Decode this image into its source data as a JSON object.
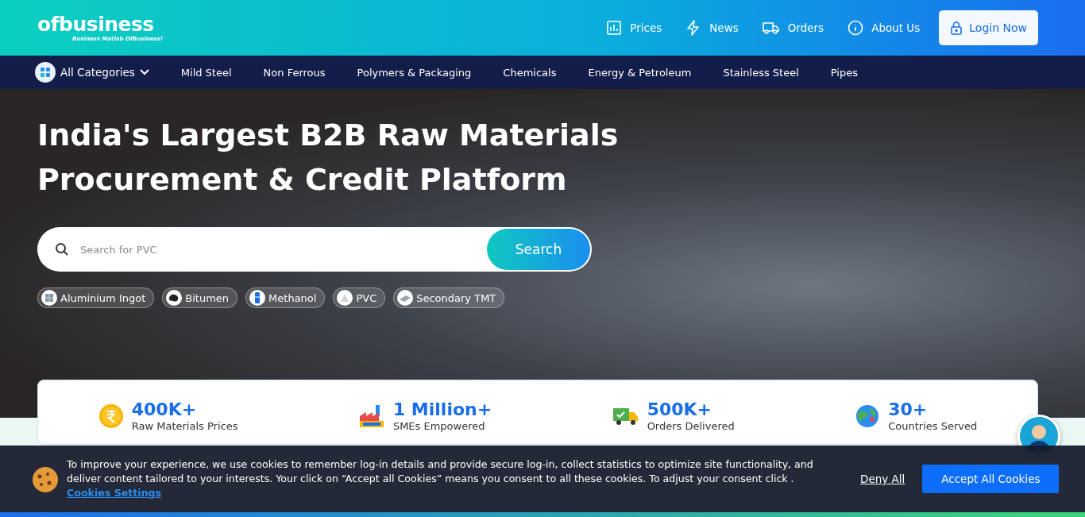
{
  "header": {
    "logo": {
      "wordmark": "ofbusiness",
      "tagline": "Business Matlab OfBusiness!"
    },
    "nav": [
      {
        "label": "Prices",
        "kind": "chart"
      },
      {
        "label": "News",
        "kind": "bolt"
      },
      {
        "label": "Orders",
        "kind": "truck"
      },
      {
        "label": "About Us",
        "kind": "info"
      }
    ],
    "login_button": "Login Now"
  },
  "category_bar": {
    "all_categories": "All Categories",
    "items": [
      "Mild Steel",
      "Non Ferrous",
      "Polymers & Packaging",
      "Chemicals",
      "Energy & Petroleum",
      "Stainless Steel",
      "Pipes"
    ]
  },
  "hero": {
    "headline": [
      "India's Largest B2B Raw Materials",
      "Procurement & Credit Platform"
    ],
    "search": {
      "placeholder": "Search for PVC",
      "button": "Search"
    },
    "chips": [
      {
        "label": "Aluminium Ingot",
        "kind": "cube"
      },
      {
        "label": "Bitumen",
        "kind": "blob"
      },
      {
        "label": "Methanol",
        "kind": "bottle"
      },
      {
        "label": "PVC",
        "kind": "powder"
      },
      {
        "label": "Secondary TMT",
        "kind": "bars"
      }
    ]
  },
  "stats": [
    {
      "value": "400K+",
      "label": "Raw Materials Prices",
      "kind": "rupee"
    },
    {
      "value": "1 Million+",
      "label": "SMEs Empowered",
      "kind": "factory"
    },
    {
      "value": "500K+",
      "label": "Orders Delivered",
      "kind": "truck"
    },
    {
      "value": "30+",
      "label": "Countries Served",
      "kind": "globe"
    }
  ],
  "cookie_banner": {
    "text": "To improve your experience, we use cookies to remember log-in details and provide secure log-in, collect statistics to optimize site functionality, and deliver content tailored to your interests. Your click on “Accept all Cookies” means you consent to all these cookies. To adjust your consent click .",
    "link": "Cookies Settings",
    "deny": "Deny All",
    "accept": "Accept All Cookies"
  }
}
